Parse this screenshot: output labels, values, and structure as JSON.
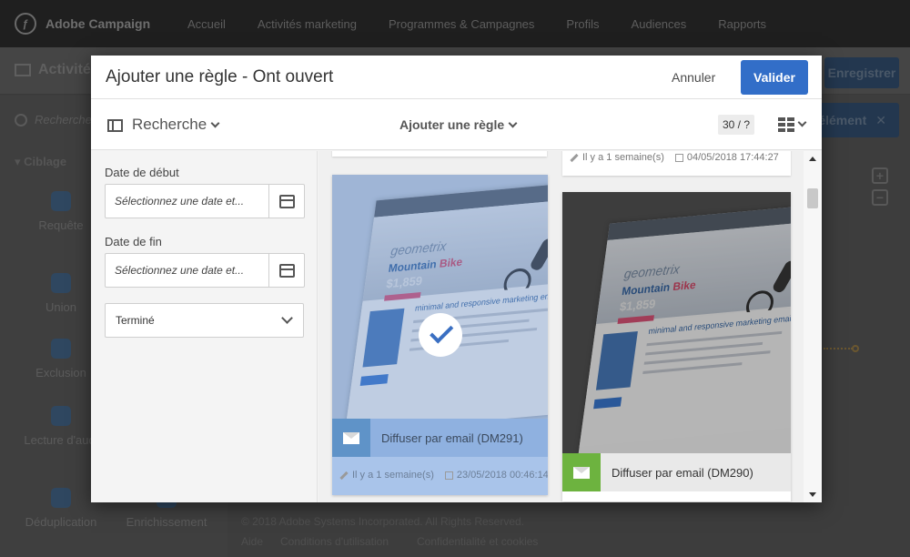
{
  "app": {
    "logo_text": "Adobe Campaign",
    "nav": [
      "Accueil",
      "Activités marketing",
      "Programmes & Campagnes",
      "Profils",
      "Audiences",
      "Rapports"
    ],
    "breadcrumb": "Activité",
    "save_label": "Enregistrer",
    "element_label": "élément",
    "search_placeholder": "Recherche...",
    "section": "Ciblage",
    "tools": [
      "Requête",
      "Union",
      "Exclusion",
      "Lecture d'audi",
      "Déduplication",
      "Enrichissement"
    ],
    "footer": {
      "copyright": "© 2018 Adobe Systems Incorporated. All Rights Reserved.",
      "links": [
        "Aide",
        "Conditions d'utilisation",
        "Confidentialité et cookies"
      ]
    }
  },
  "modal": {
    "title": "Ajouter une règle - Ont ouvert",
    "cancel_label": "Annuler",
    "validate_label": "Valider",
    "toolbar": {
      "search_label": "Recherche",
      "add_rule_label": "Ajouter une règle",
      "count": "30 / ?"
    },
    "filters": {
      "start_label": "Date de début",
      "start_placeholder": "Sélectionnez une date et...",
      "end_label": "Date de fin",
      "end_placeholder": "Sélectionnez une date et...",
      "status_value": "Terminé"
    },
    "gallery": {
      "top_right_meta": {
        "age": "Il y a 1 semaine(s)",
        "date": "04/05/2018 17:44:27"
      },
      "cards": [
        {
          "label": "Diffuser par email (DM291)",
          "age": "Il y a 1 semaine(s)",
          "date": "23/05/2018 00:46:14",
          "selected": true,
          "brand": "geometrix",
          "headline_a": "Mountain",
          "headline_b": "Bike",
          "price": "$1,859",
          "body_title": "minimal and responsive marketing email template"
        },
        {
          "label": "Diffuser par email (DM290)",
          "selected": false,
          "brand": "geometrix",
          "headline_a": "Mountain",
          "headline_b": "Bike",
          "price": "$1,859",
          "body_title": "minimal and responsive marketing email template"
        }
      ]
    }
  },
  "colors": {
    "primary": "#326ec8",
    "selected_card": "#a9c4ea",
    "mail_icon_selected": "#5f93c8",
    "mail_icon": "#6db33f",
    "overlay": "#3d3d3d"
  }
}
